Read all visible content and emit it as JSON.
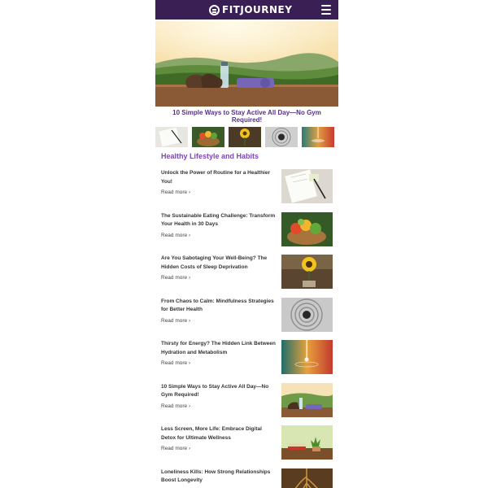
{
  "header": {
    "brand": "FITJOURNEY",
    "menu_icon": "hamburger-icon"
  },
  "hero": {
    "title": "10 Simple Ways to Stay Active All Day—No Gym Required!"
  },
  "thumbnails": [
    "notebook-image",
    "vegetable-basket-image",
    "sunflower-image",
    "zen-stone-image",
    "water-drop-image"
  ],
  "section": {
    "title": "Healthy Lifestyle and Habits"
  },
  "articles": [
    {
      "title": "Unlock the Power of Routine for a Healthier You!",
      "read_more": "Read more ›"
    },
    {
      "title": "The Sustainable Eating Challenge: Transform Your Health in 30 Days",
      "read_more": "Read more ›"
    },
    {
      "title": "Are You Sabotaging Your Well-Being? The Hidden Costs of Sleep Deprivation",
      "read_more": "Read more ›"
    },
    {
      "title": "From Chaos to Calm: Mindfulness Strategies for Better Health",
      "read_more": "Read more ›"
    },
    {
      "title": "Thirsty for Energy? The Hidden Link Between Hydration and Metabolism",
      "read_more": "Read more ›"
    },
    {
      "title": "10 Simple Ways to Stay Active All Day—No Gym Required!",
      "read_more": "Read more ›"
    },
    {
      "title": "Less Screen, More Life: Embrace Digital Detox for Ultimate Wellness",
      "read_more": "Read more ›"
    },
    {
      "title": "Loneliness Kills: How Strong Relationships Boost Longevity",
      "read_more": ""
    }
  ],
  "colors": {
    "header_bg": "#3a1f55",
    "accent": "#7b46b8",
    "hero_title": "#553188"
  }
}
